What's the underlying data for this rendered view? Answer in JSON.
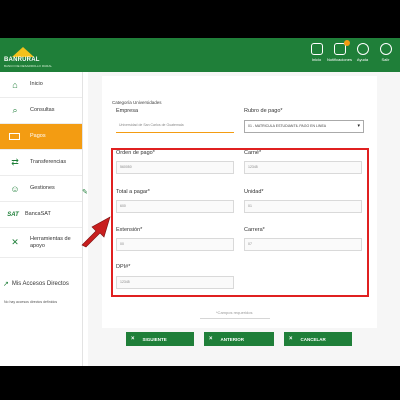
{
  "header": {
    "logo_text": "BANRURAL",
    "logo_sub": "BANCO DE DESARROLLO RURAL",
    "icons": [
      {
        "name": "home-icon",
        "label": "Inicio"
      },
      {
        "name": "bell-icon",
        "label": "Notificaciones"
      },
      {
        "name": "help-icon",
        "label": "Ayuda"
      },
      {
        "name": "power-icon",
        "label": "Salir"
      }
    ]
  },
  "sidebar": {
    "items": [
      {
        "label": "Inicio",
        "icon": "home-icon",
        "active": false
      },
      {
        "label": "Consultas",
        "icon": "search-icon",
        "active": false
      },
      {
        "label": "Pagos",
        "icon": "card-icon",
        "active": true
      },
      {
        "label": "Transferencias",
        "icon": "transfer-icon",
        "active": false
      },
      {
        "label": "Gestiones",
        "icon": "people-icon",
        "active": false
      },
      {
        "label": "BancaSAT",
        "icon": "sat-logo",
        "active": false
      },
      {
        "label": "Herramientas de apoyo",
        "icon": "tools-icon",
        "active": false
      }
    ],
    "accesos_title": "Mis Accesos Directos",
    "accesos_empty": "No hay accesos directos definidos"
  },
  "form": {
    "category_label": "Categoría Universidades",
    "empresa_label": "Empresa",
    "empresa_value": "Universidad de San Carlos de Guatemala",
    "rubro_label": "Rubro de pago*",
    "rubro_value": "01 - MATRICULA ESTUDIANTIL PAGO EN LINEA",
    "orden_label": "Orden de pago*",
    "orden_value": "560050",
    "carne_label": "Carné*",
    "carne_value": "12345",
    "total_label": "Total a pagar*",
    "total_value": "600",
    "unidad_label": "Unidad*",
    "unidad_value": "01",
    "extension_label": "Extensión*",
    "extension_value": "00",
    "carrera_label": "Carrera*",
    "carrera_value": "07",
    "dpi_label": "DPI#*",
    "dpi_value": "12345",
    "required_note": "*Campos requeridos"
  },
  "buttons": {
    "siguiente": "SIGUIENTE",
    "anterior": "ANTERIOR",
    "cancelar": "CANCELAR"
  },
  "colors": {
    "brand_green": "#1f7f39",
    "accent_orange": "#f39c12",
    "highlight_red": "#e02020"
  }
}
